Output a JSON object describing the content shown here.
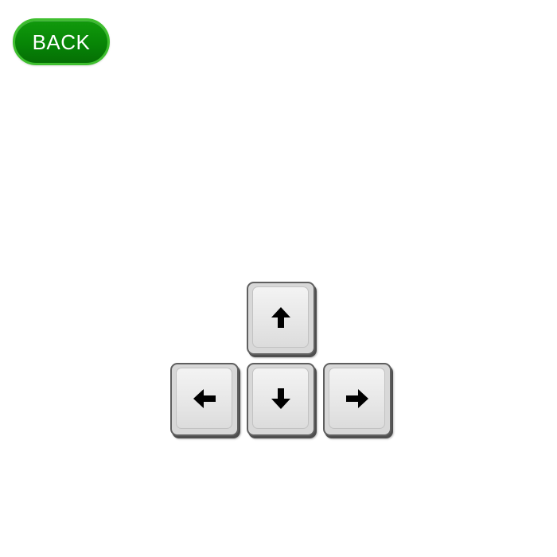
{
  "header": {
    "back_label": "BACK",
    "back_color": "#078506",
    "back_border_color": "#3fbf2f"
  },
  "arrow_keys": {
    "up": {
      "icon": "arrow-up-icon"
    },
    "left": {
      "icon": "arrow-left-icon"
    },
    "down": {
      "icon": "arrow-down-icon"
    },
    "right": {
      "icon": "arrow-right-icon"
    },
    "key_face_color": "#e6e6e6",
    "key_border_color": "#5f5f5f",
    "arrow_color": "#000000"
  }
}
